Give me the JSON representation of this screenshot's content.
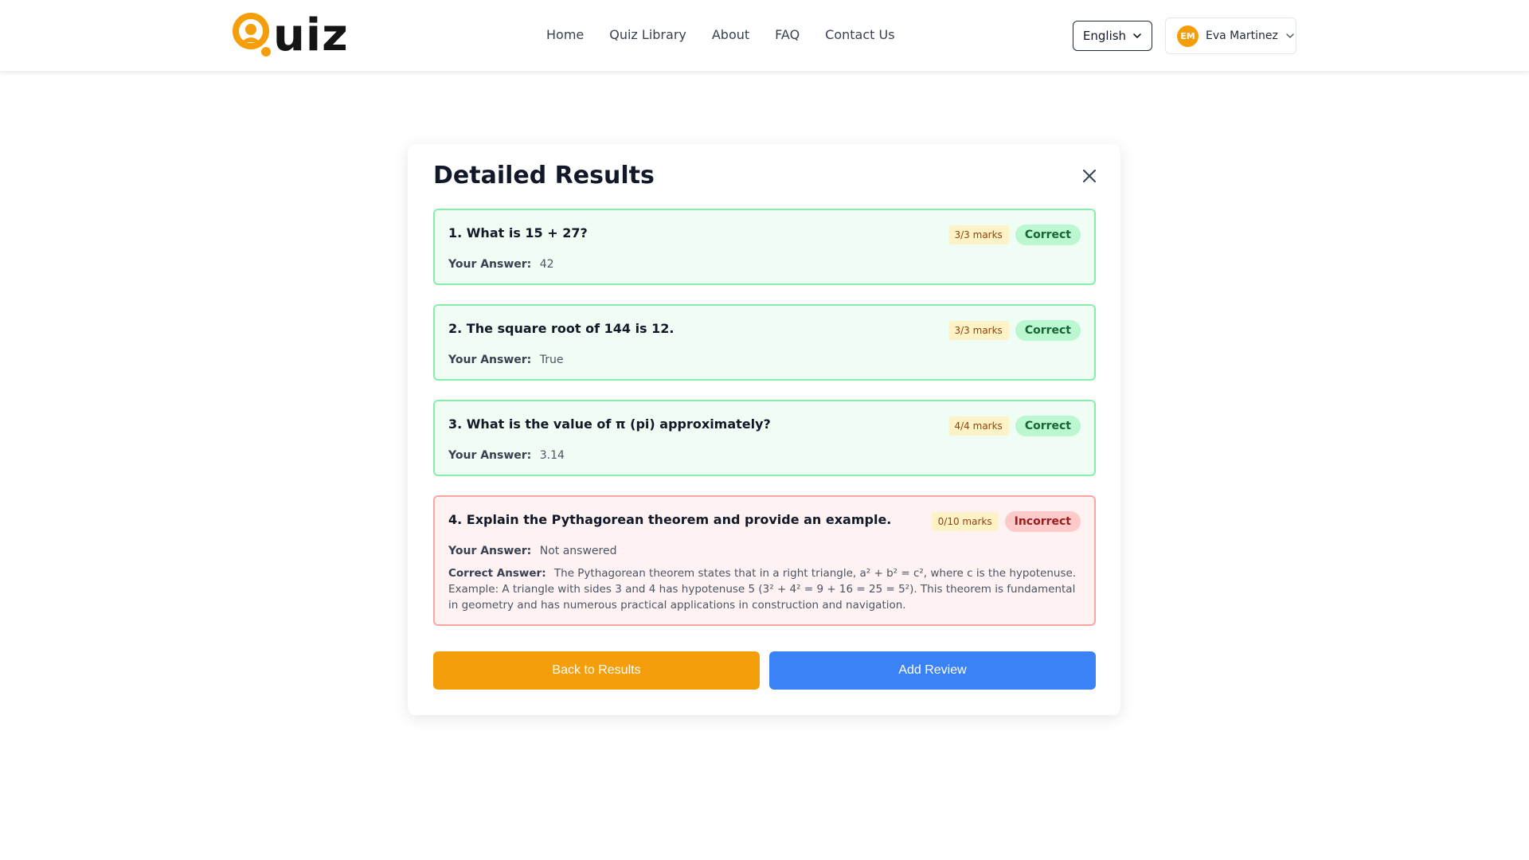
{
  "brand": {
    "logo_text": "uiz",
    "accent_color": "#f59e0b"
  },
  "nav": {
    "items": [
      "Home",
      "Quiz Library",
      "About",
      "FAQ",
      "Contact Us"
    ]
  },
  "language": {
    "selected": "English",
    "icon": "chevron-down-icon"
  },
  "user": {
    "initials": "EM",
    "name": "Eva Martinez",
    "icon": "chevron-down-icon"
  },
  "modal": {
    "title": "Detailed Results",
    "close_icon": "close-icon",
    "answer_label": "Your Answer:",
    "correct_answer_label": "Correct Answer:",
    "questions": [
      {
        "question": "1. What is 15 + 27?",
        "marks": "3/3 marks",
        "status": "Correct",
        "answer": "42"
      },
      {
        "question": "2. The square root of 144 is 12.",
        "marks": "3/3 marks",
        "status": "Correct",
        "answer": "True"
      },
      {
        "question": "3. What is the value of π (pi) approximately?",
        "marks": "4/4 marks",
        "status": "Correct",
        "answer": "3.14"
      },
      {
        "question": "4. Explain the Pythagorean theorem and provide an example.",
        "marks": "0/10 marks",
        "status": "Incorrect",
        "answer": "Not answered",
        "correct_answer": "The Pythagorean theorem states that in a right triangle, a² + b² = c², where c is the hypotenuse. Example: A triangle with sides 3 and 4 has hypotenuse 5 (3² + 4² = 9 + 16 = 25 = 5²). This theorem is fundamental in geometry and has numerous practical applications in construction and navigation."
      }
    ],
    "buttons": {
      "back": "Back to Results",
      "review": "Add Review"
    }
  },
  "colors": {
    "correct_bg": "#f0fdf4",
    "correct_border": "#86efac",
    "incorrect_bg": "#fef2f2",
    "incorrect_border": "#fca5a5",
    "back_button": "#f59e0b",
    "review_button": "#3b82f6"
  }
}
